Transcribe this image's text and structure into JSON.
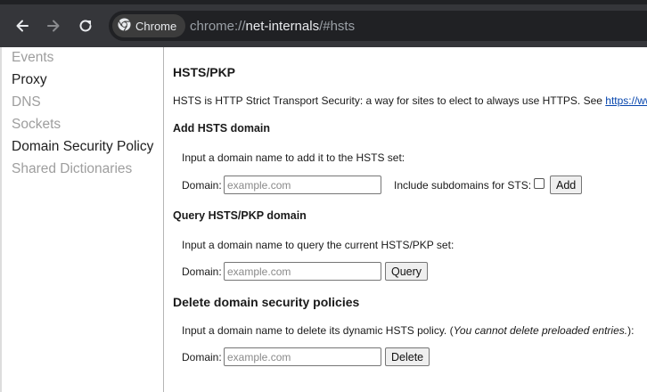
{
  "browser": {
    "chip_label": "Chrome",
    "url_scheme": "chrome://",
    "url_host": "net-internals",
    "url_path": "/#hsts"
  },
  "sidebar": {
    "items": [
      {
        "label": "Events",
        "active": false
      },
      {
        "label": "Proxy",
        "active": true
      },
      {
        "label": "DNS",
        "active": false
      },
      {
        "label": "Sockets",
        "active": false
      },
      {
        "label": "Domain Security Policy",
        "active": true
      },
      {
        "label": "Shared Dictionaries",
        "active": false
      }
    ]
  },
  "main": {
    "title": "HSTS/PKP",
    "intro": "HSTS is HTTP Strict Transport Security: a way for sites to elect to always use HTTPS. See",
    "intro_link": "https://www.chromium.org/hsts",
    "add": {
      "heading": "Add HSTS domain",
      "instruction": "Input a domain name to add it to the HSTS set:",
      "domain_label": "Domain:",
      "placeholder": "example.com",
      "subdomains_label": "Include subdomains for STS:",
      "button": "Add"
    },
    "query": {
      "heading": "Query HSTS/PKP domain",
      "instruction": "Input a domain name to query the current HSTS/PKP set:",
      "domain_label": "Domain:",
      "placeholder": "example.com",
      "button": "Query"
    },
    "delete": {
      "heading": "Delete domain security policies",
      "instruction": "Input a domain name to delete its dynamic HSTS policy. (",
      "instruction_em": "You cannot delete preloaded entries.",
      "instruction_end": "):",
      "domain_label": "Domain:",
      "placeholder": "example.com",
      "button": "Delete"
    }
  },
  "colors": {
    "toolbar": "#35363a",
    "omnibox": "#202124",
    "link": "#0645ad"
  }
}
